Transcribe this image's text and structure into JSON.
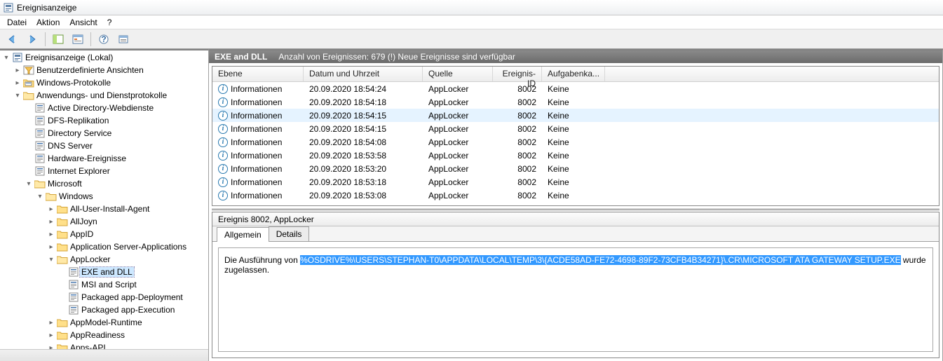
{
  "window": {
    "title": "Ereignisanzeige"
  },
  "menu": {
    "file": "Datei",
    "action": "Aktion",
    "view": "Ansicht",
    "help": "?"
  },
  "tree": {
    "root": "Ereignisanzeige (Lokal)",
    "custom_views": "Benutzerdefinierte Ansichten",
    "windows_logs": "Windows-Protokolle",
    "apps_services": "Anwendungs- und Dienstprotokolle",
    "ad_web": "Active Directory-Webdienste",
    "dfs": "DFS-Replikation",
    "dirsvc": "Directory Service",
    "dns": "DNS Server",
    "hw": "Hardware-Ereignisse",
    "ie": "Internet Explorer",
    "ms": "Microsoft",
    "win": "Windows",
    "all_user": "All-User-Install-Agent",
    "alljoyn": "AllJoyn",
    "appid": "AppID",
    "app_srv": "Application Server-Applications",
    "applocker": "AppLocker",
    "exe_dll": "EXE and DLL",
    "msi": "MSI and Script",
    "pkg_dep": "Packaged app-Deployment",
    "pkg_exe": "Packaged app-Execution",
    "appmodel": "AppModel-Runtime",
    "appready": "AppReadiness",
    "appsapi": "Apps-API"
  },
  "content_header": {
    "log_name": "EXE and DLL",
    "summary": "Anzahl von Ereignissen: 679 (!) Neue Ereignisse sind verfügbar"
  },
  "columns": {
    "level": "Ebene",
    "time": "Datum und Uhrzeit",
    "source": "Quelle",
    "id": "Ereignis-ID",
    "task": "Aufgabenka..."
  },
  "level_label": "Informationen",
  "events": [
    {
      "time": "20.09.2020 18:54:24",
      "source": "AppLocker",
      "id": "8002",
      "task": "Keine"
    },
    {
      "time": "20.09.2020 18:54:18",
      "source": "AppLocker",
      "id": "8002",
      "task": "Keine"
    },
    {
      "time": "20.09.2020 18:54:15",
      "source": "AppLocker",
      "id": "8002",
      "task": "Keine",
      "selected": true
    },
    {
      "time": "20.09.2020 18:54:15",
      "source": "AppLocker",
      "id": "8002",
      "task": "Keine"
    },
    {
      "time": "20.09.2020 18:54:08",
      "source": "AppLocker",
      "id": "8002",
      "task": "Keine"
    },
    {
      "time": "20.09.2020 18:53:58",
      "source": "AppLocker",
      "id": "8002",
      "task": "Keine"
    },
    {
      "time": "20.09.2020 18:53:20",
      "source": "AppLocker",
      "id": "8002",
      "task": "Keine"
    },
    {
      "time": "20.09.2020 18:53:18",
      "source": "AppLocker",
      "id": "8002",
      "task": "Keine"
    },
    {
      "time": "20.09.2020 18:53:08",
      "source": "AppLocker",
      "id": "8002",
      "task": "Keine"
    }
  ],
  "detail": {
    "header": "Ereignis 8002, AppLocker",
    "tab_general": "Allgemein",
    "tab_details": "Details",
    "msg_pre": "Die Ausführung von ",
    "msg_path": "%OSDRIVE%\\USERS\\STEPHAN-T0\\APPDATA\\LOCAL\\TEMP\\3\\{ACDE58AD-FE72-4698-89F2-73CFB4B34271}\\.CR\\MICROSOFT ATA GATEWAY SETUP.EXE",
    "msg_post": " wurde zugelassen."
  }
}
